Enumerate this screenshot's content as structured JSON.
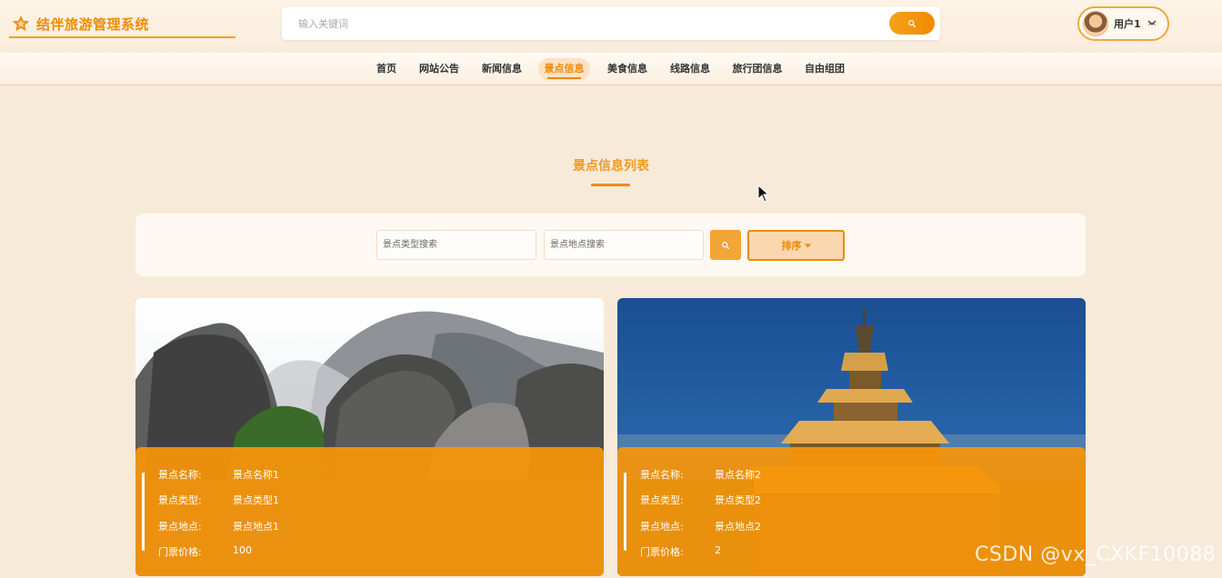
{
  "header": {
    "logo_icon": "star-icon",
    "app_title": "结伴旅游管理系统",
    "search_placeholder": "输入关键词",
    "user_name": "用户1",
    "user_caret": "⌄"
  },
  "nav": {
    "items": [
      {
        "label": "首页"
      },
      {
        "label": "网站公告"
      },
      {
        "label": "新闻信息"
      },
      {
        "label": "景点信息",
        "active": true
      },
      {
        "label": "美食信息"
      },
      {
        "label": "线路信息"
      },
      {
        "label": "旅行团信息"
      },
      {
        "label": "自由组团"
      }
    ]
  },
  "main": {
    "page_title": "景点信息列表",
    "filters": {
      "type_placeholder": "景点类型搜索",
      "location_placeholder": "景点地点搜索",
      "sort_label": "排序"
    },
    "cards": [
      {
        "image": "mountain-rock-photo",
        "rows": [
          {
            "label": "景点名称:",
            "value": "景点名称1"
          },
          {
            "label": "景点类型:",
            "value": "景点类型1"
          },
          {
            "label": "景点地点:",
            "value": "景点地点1"
          },
          {
            "label": "门票价格:",
            "value": "100"
          }
        ]
      },
      {
        "image": "wooden-tower-photo",
        "rows": [
          {
            "label": "景点名称:",
            "value": "景点名称2"
          },
          {
            "label": "景点类型:",
            "value": "景点类型2"
          },
          {
            "label": "景点地点:",
            "value": "景点地点2"
          },
          {
            "label": "门票价格:",
            "value": "2"
          }
        ]
      }
    ]
  },
  "watermark": "CSDN @vx_CXKF10088",
  "colors": {
    "accent": "#ef8a00",
    "background": "#f7ead9",
    "card_overlay": "#f7960a"
  }
}
